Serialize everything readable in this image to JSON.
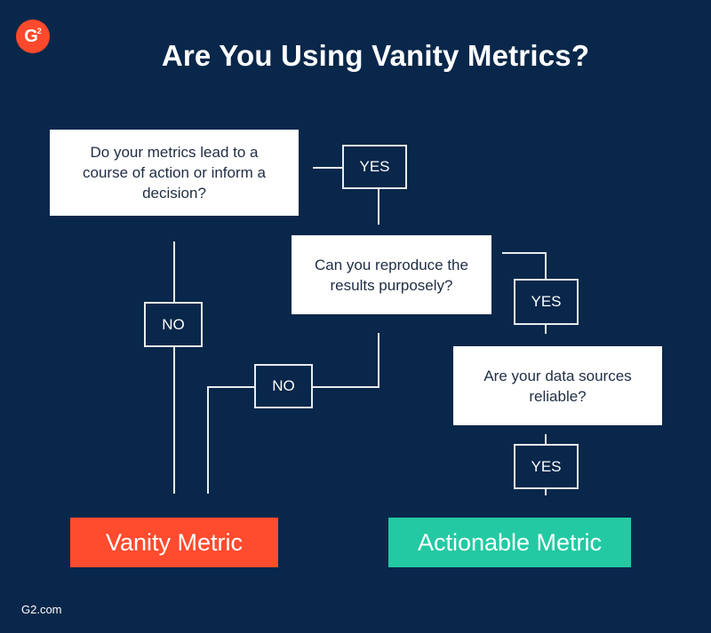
{
  "logo": {
    "letter": "G",
    "sup": "2"
  },
  "title": "Are You Using Vanity Metrics?",
  "questions": [
    "Do your metrics lead to a course of action or inform a decision?",
    "Can you reproduce the results purposely?",
    "Are your data sources reliable?"
  ],
  "labels": {
    "yes": "YES",
    "no": "NO"
  },
  "results": {
    "vanity": {
      "label": "Vanity Metric",
      "color": "#ff4b2e"
    },
    "actionable": {
      "label": "Actionable Metric",
      "color": "#23c9a3"
    }
  },
  "footer": "G2.com"
}
